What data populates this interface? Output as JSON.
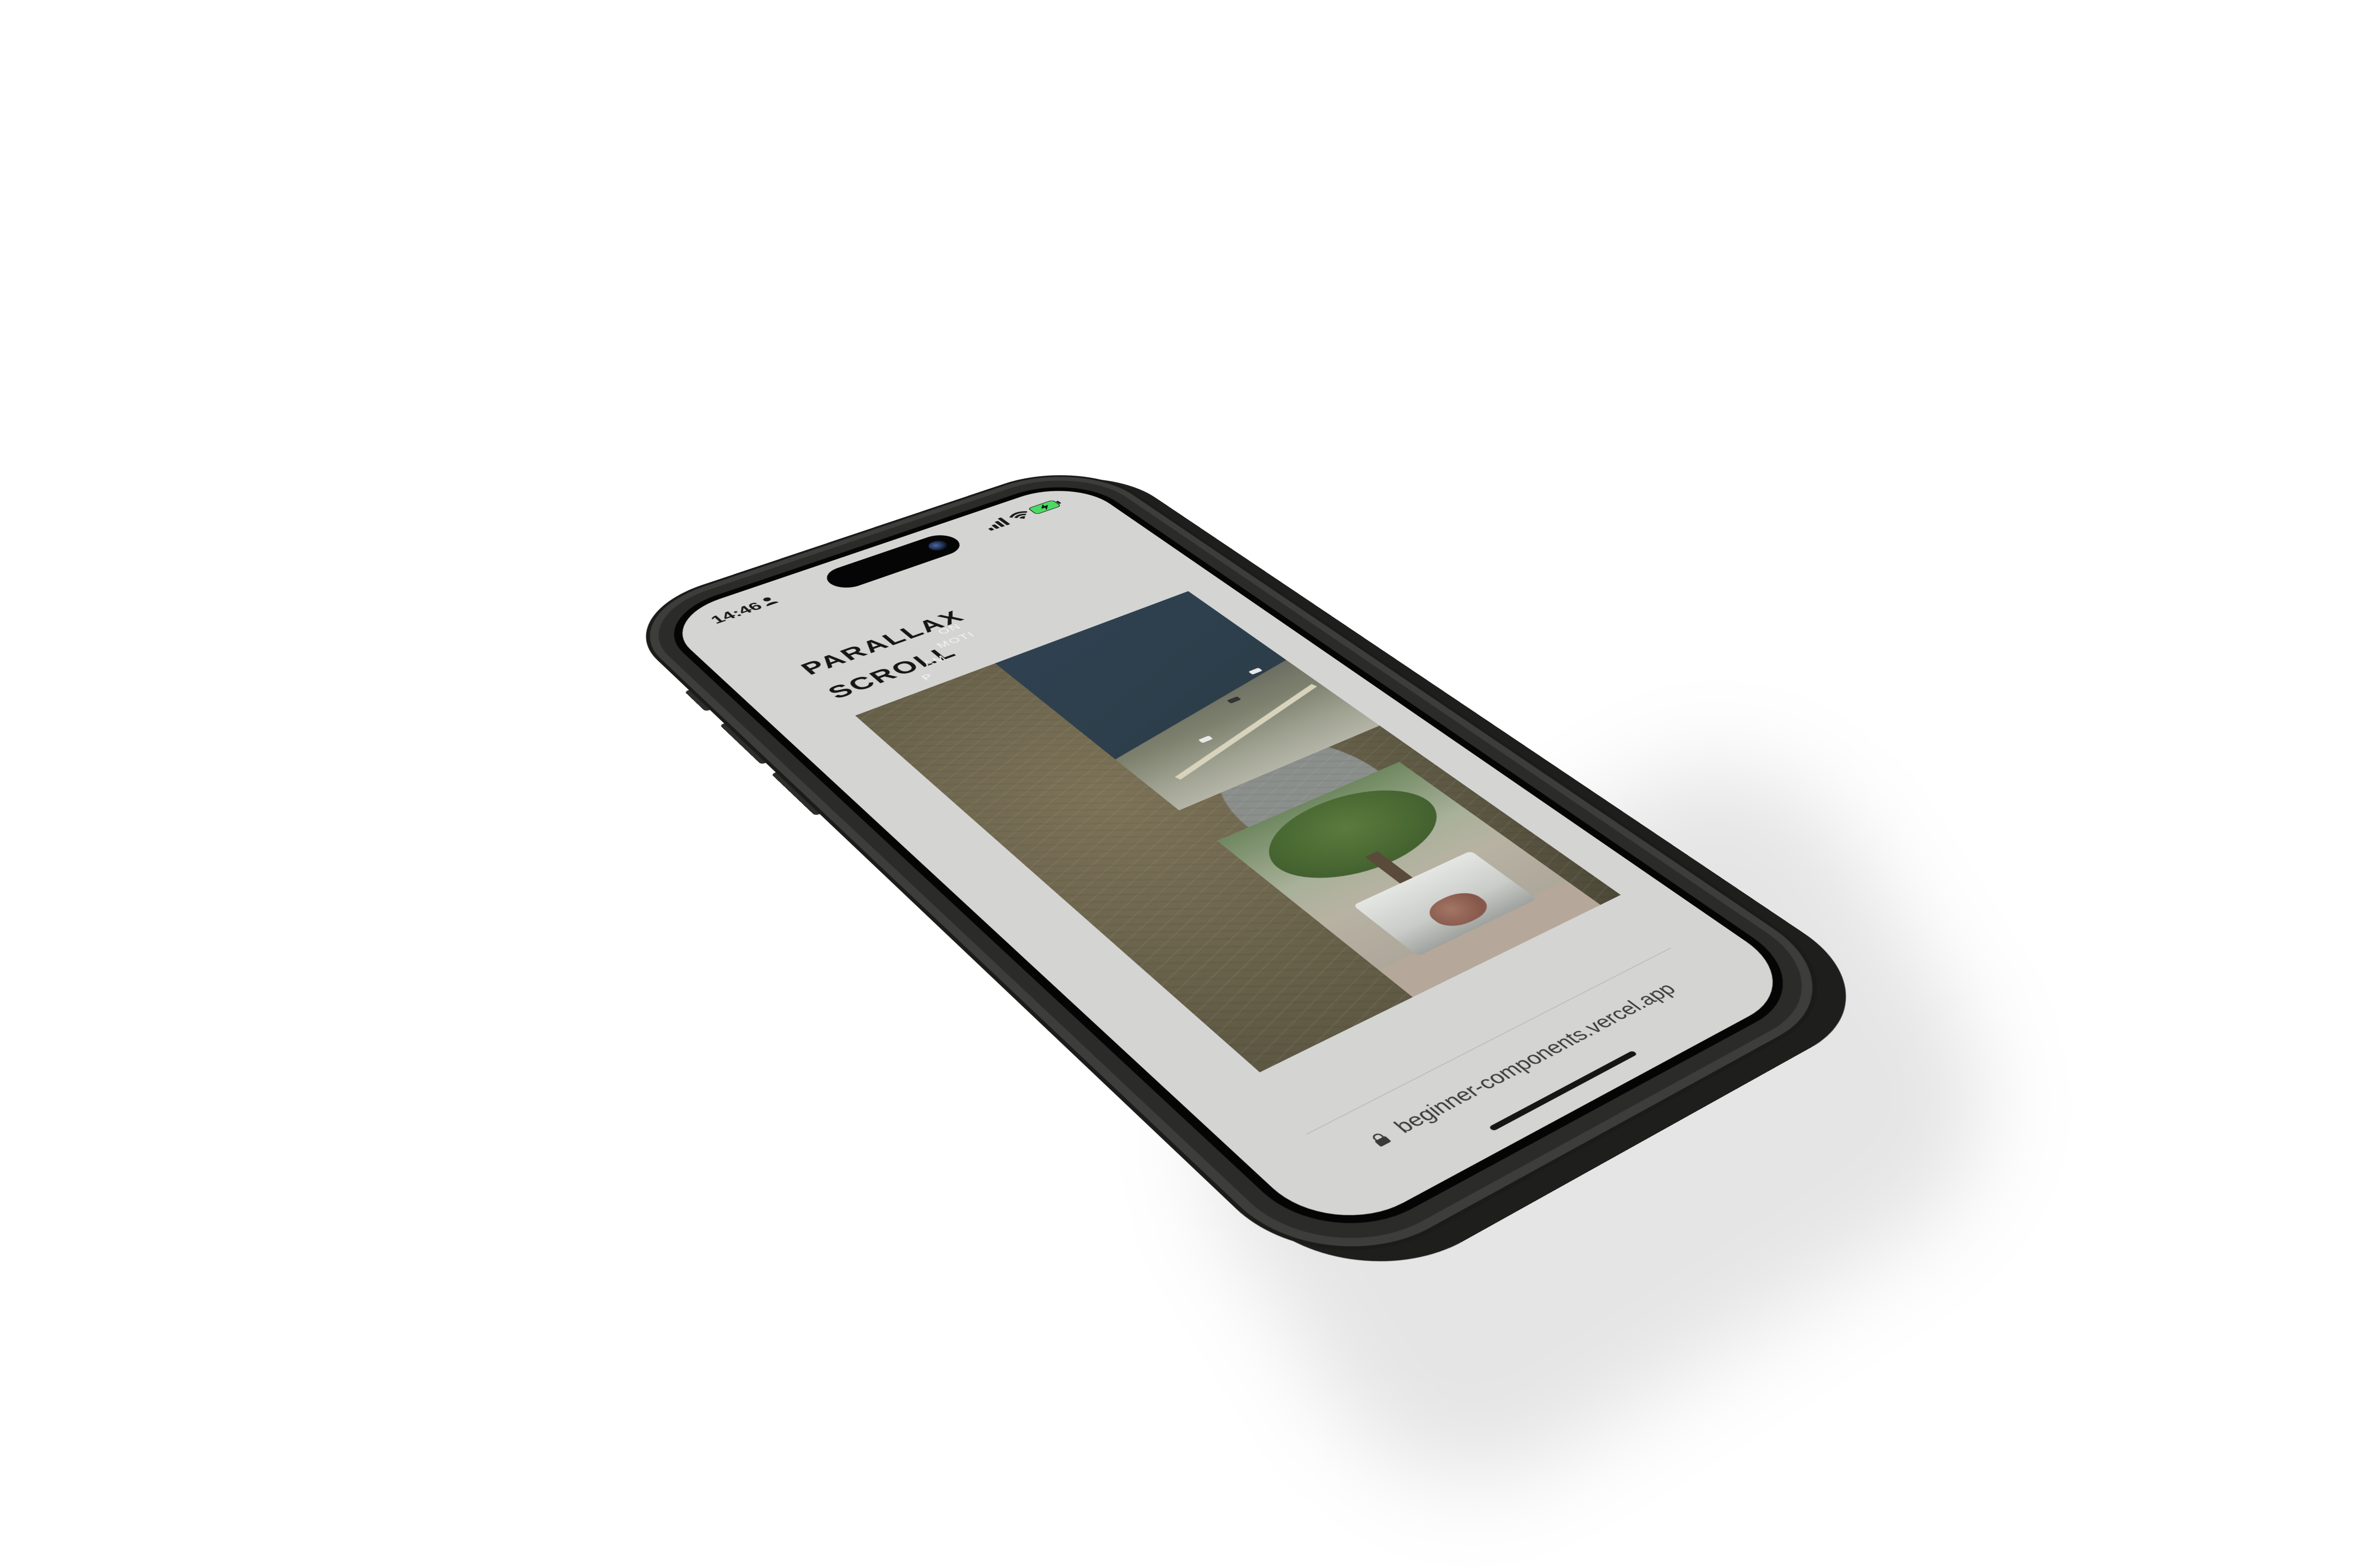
{
  "status_bar": {
    "time": "14:46",
    "person_icon": "person-icon",
    "signal_icon": "cellular-signal-icon",
    "wifi_icon": "wifi-icon",
    "battery_icon": "battery-charging-icon"
  },
  "page": {
    "title_line_1": "PARALLAX",
    "title_line_2": "SCROLL",
    "overlap_text_1": "ON",
    "overlap_text_2": "MOTI",
    "overlap_text_3": "AM",
    "overlap_text_4": "P"
  },
  "images": {
    "image_1": "rock-canyon-photo",
    "image_2": "highway-road-photo",
    "image_3": "truck-under-tree-photo"
  },
  "browser": {
    "url": "beginner-components.vercel.app",
    "lock_icon": "lock-icon"
  },
  "colors": {
    "screen_background": "#d4d4d2",
    "title_text": "#161616",
    "phone_frame": "#2b2c2a"
  }
}
